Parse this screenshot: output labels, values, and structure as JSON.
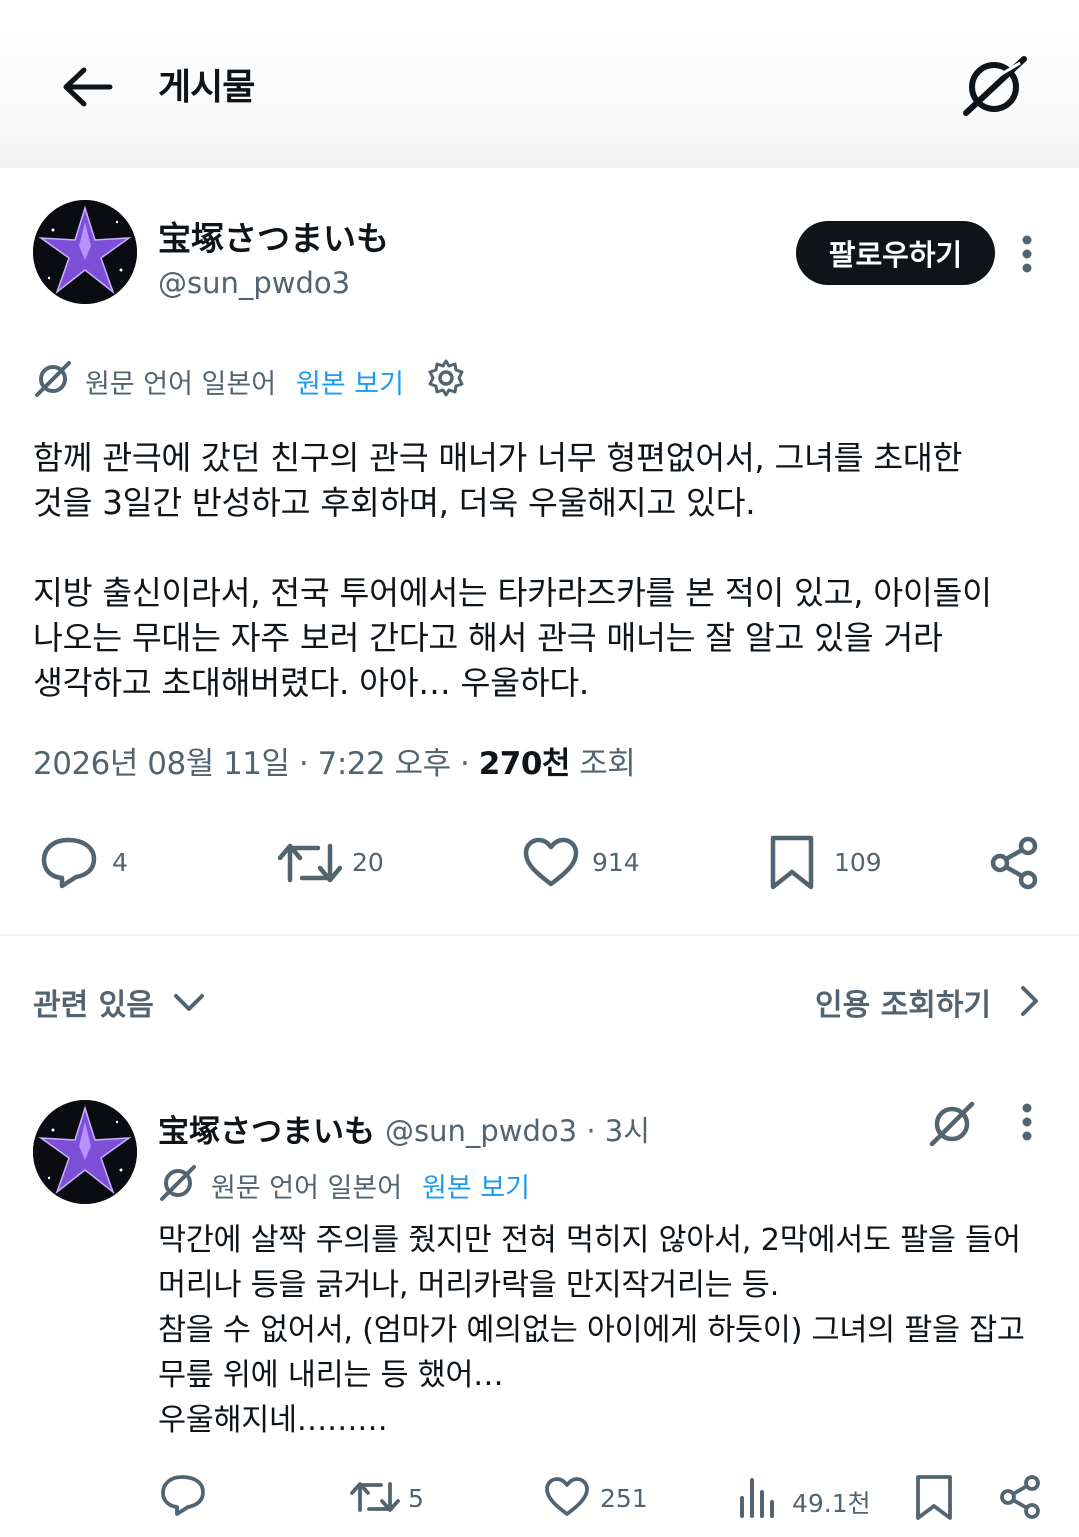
{
  "header": {
    "title": "게시물",
    "back_icon": "arrow-left-icon",
    "grok_icon": "grok-icon"
  },
  "post": {
    "author_name": "宝塚さつまいも",
    "author_handle": "@sun_pwdo3",
    "follow_label": "팔로우하기",
    "translation": {
      "source": "원문 언어 일본어",
      "show_original": "원본 보기"
    },
    "text_lines": [
      "함께 관극에 갔던 친구의 관극 매너가 너무 형편없어서, 그녀를 초대한",
      "것을 3일간 반성하고 후회하며, 더욱 우울해지고 있다.",
      "",
      "지방 출신이라서, 전국 투어에서는 타카라즈카를 본 적이 있고, 아이돌이",
      "나오는 무대는 자주 보러 간다고 해서 관극 매너는 잘 알고 있을 거라",
      "생각하고 초대해버렸다. 아아… 우울하다."
    ],
    "timestamp": "2026년 08월 11일 · 7:22 오후 · ",
    "views_count": "270천",
    "views_label": " 조회",
    "actions": {
      "replies": "4",
      "reposts": "20",
      "likes": "914",
      "bookmarks": "109"
    }
  },
  "related": {
    "label": "관련 있음",
    "quotes_label": "인용 조회하기"
  },
  "reply": {
    "author_name": "宝塚さつまいも",
    "author_handle": "@sun_pwdo3 · 3시",
    "translation": {
      "source": "원문 언어 일본어",
      "show_original": "원본 보기"
    },
    "text_lines": [
      "막간에 살짝 주의를 줬지만 전혀 먹히지 않아서, 2막에서도 팔을 들어",
      "머리나 등을 긁거나, 머리카락을 만지작거리는 등.",
      "참을 수 없어서, (엄마가 예의없는 아이에게 하듯이) 그녀의 팔을 잡고",
      "무릎 위에 내리는 등 했어…",
      "우울해지네………"
    ],
    "actions": {
      "reposts": "5",
      "likes": "251",
      "views": "49.1천"
    }
  },
  "colors": {
    "text": "#0f1419",
    "muted": "#536471",
    "link": "#1d9bf0",
    "avatar_petal": "#8a5ee0"
  }
}
